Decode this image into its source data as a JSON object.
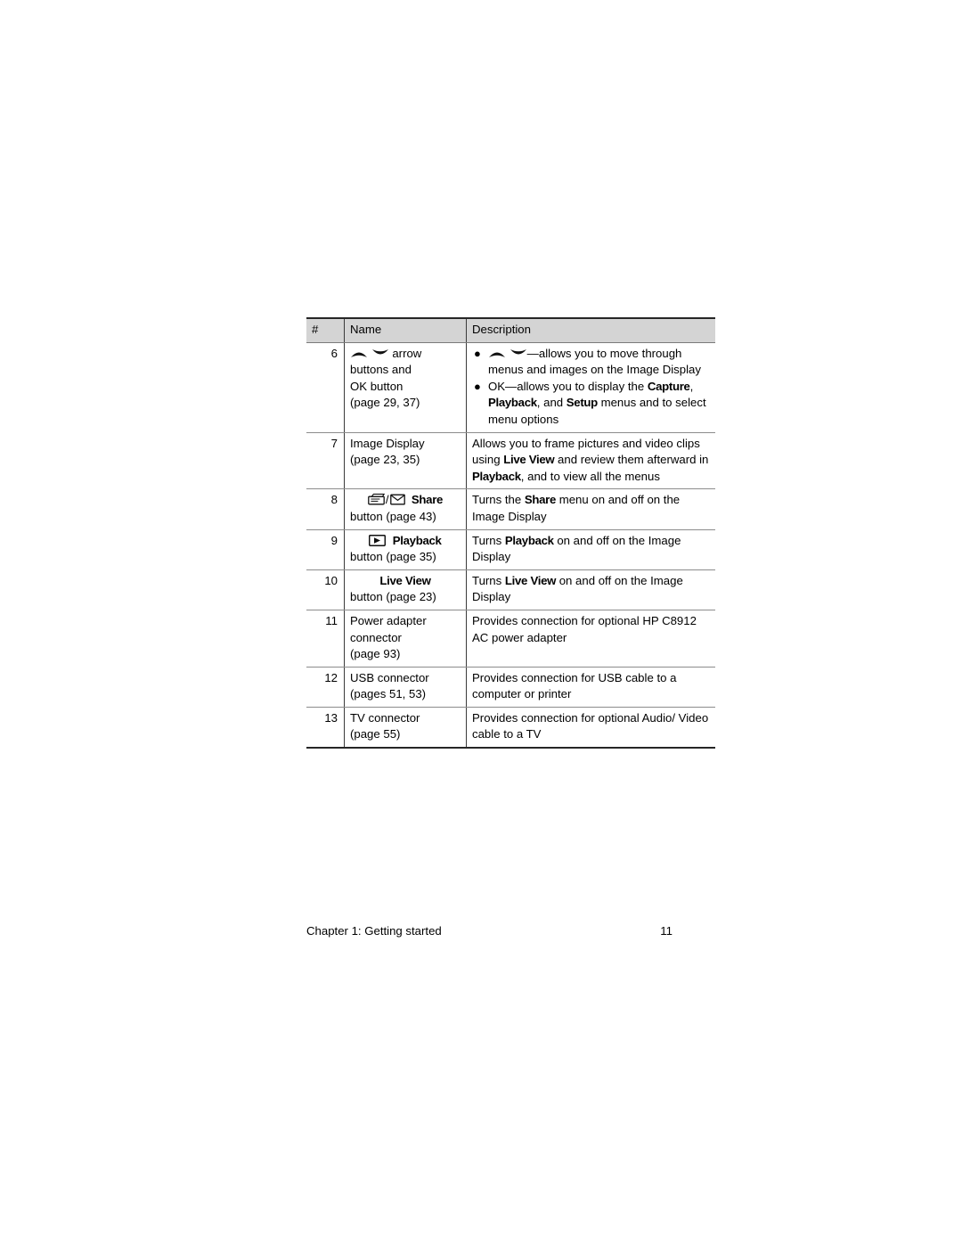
{
  "document": {
    "footer": {
      "chapter": "Chapter 1: Getting started",
      "page_number": "11"
    }
  },
  "table": {
    "headers": {
      "number": "#",
      "name": "Name",
      "description": "Description"
    },
    "rows": [
      {
        "number": "6",
        "name": {
          "line1_suffix": "arrow",
          "line2": "buttons and",
          "line3": "OK button",
          "line4": "(page 29, 37)"
        },
        "description_items": [
          {
            "prefix_icons": true,
            "text": "—allows you to move through menus and images on the Image Display"
          },
          {
            "prefix_icons": false,
            "text_a": "OK—allows you to display the ",
            "ui_1": "Capture",
            "text_b": ", ",
            "ui_2": "Playback",
            "text_c": ", and ",
            "ui_3": "Setup",
            "text_d": " menus and to select menu options"
          }
        ]
      },
      {
        "number": "7",
        "name": {
          "line1": "Image Display",
          "line2": "(page 23, 35)"
        },
        "description": {
          "text_a": "Allows you to frame pictures and video clips using ",
          "ui_1": "Live View",
          "text_b": " and review them afterward in ",
          "ui_2": "Playback",
          "text_c": ", and to view all the menus"
        }
      },
      {
        "number": "8",
        "name": {
          "label": "Share",
          "line2": "button (page 43)"
        },
        "description": {
          "text_a": "Turns the ",
          "ui_1": "Share",
          "text_b": " menu on and off on the Image Display"
        }
      },
      {
        "number": "9",
        "name": {
          "label": "Playback",
          "line2": "button (page 35)"
        },
        "description": {
          "text_a": "Turns ",
          "ui_1": "Playback",
          "text_b": " on and off on the Image Display"
        }
      },
      {
        "number": "10",
        "name": {
          "label": "Live View",
          "line2": "button (page 23)"
        },
        "description": {
          "text_a": "Turns ",
          "ui_1": "Live View",
          "text_b": " on and off on the Image Display"
        }
      },
      {
        "number": "11",
        "name": {
          "line1": "Power adapter",
          "line2": "connector",
          "line3": "(page 93)"
        },
        "description": {
          "text_a": "Provides connection for optional HP C8912 AC power adapter"
        }
      },
      {
        "number": "12",
        "name": {
          "line1": "USB connector",
          "line2": "(pages 51, 53)"
        },
        "description": {
          "text_a": "Provides connection for USB cable to a computer or printer"
        }
      },
      {
        "number": "13",
        "name": {
          "line1": "TV connector",
          "line2": "(page 55)"
        },
        "description": {
          "text_a": "Provides connection for optional Audio/ Video cable to a TV"
        }
      }
    ]
  },
  "icons": {
    "arrow_up": "arrow-up-icon",
    "arrow_down": "arrow-down-icon",
    "printer": "printer-icon",
    "envelope": "envelope-icon",
    "play": "play-icon"
  },
  "colors": {
    "header_background": "#d4d4d4",
    "rule_heavy": "#262626",
    "rule_light": "#8c8c8c",
    "text": "#000000"
  }
}
